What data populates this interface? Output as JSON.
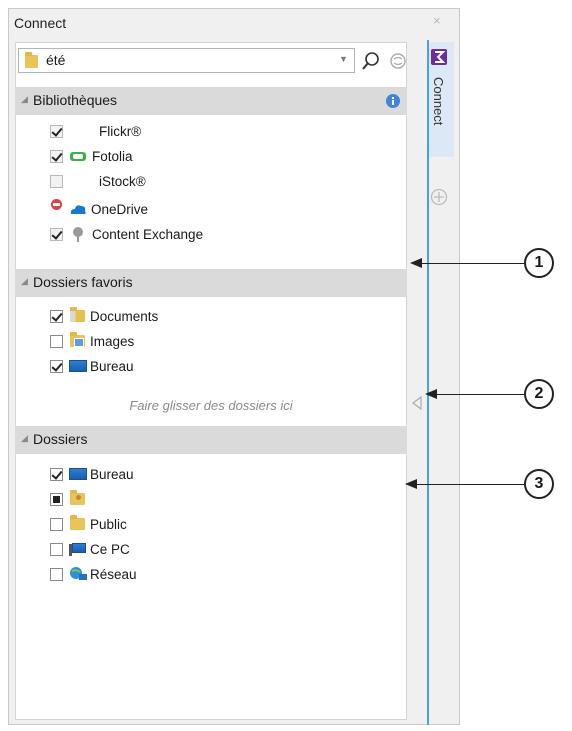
{
  "panel": {
    "title": "Connect",
    "close_glyph": "×"
  },
  "search": {
    "value": "été"
  },
  "side_tab": {
    "label": "Connect"
  },
  "sections": {
    "libraries": {
      "title": "Bibliothèques",
      "items": [
        "Flickr®",
        "Fotolia",
        "iStock®",
        "OneDrive",
        "Content Exchange"
      ]
    },
    "favorites": {
      "title": "Dossiers favoris",
      "items": [
        "Documents",
        "Images",
        "Bureau"
      ],
      "drop_hint": "Faire glisser des dossiers ici"
    },
    "folders": {
      "title": "Dossiers",
      "items": [
        "Bureau",
        "",
        "Public",
        "Ce PC",
        "Réseau"
      ]
    }
  },
  "callouts": [
    "1",
    "2",
    "3"
  ],
  "colors": {
    "accent": "#4aa0e0",
    "header_bg": "#dadada",
    "tab_bg": "#dce8f5"
  }
}
